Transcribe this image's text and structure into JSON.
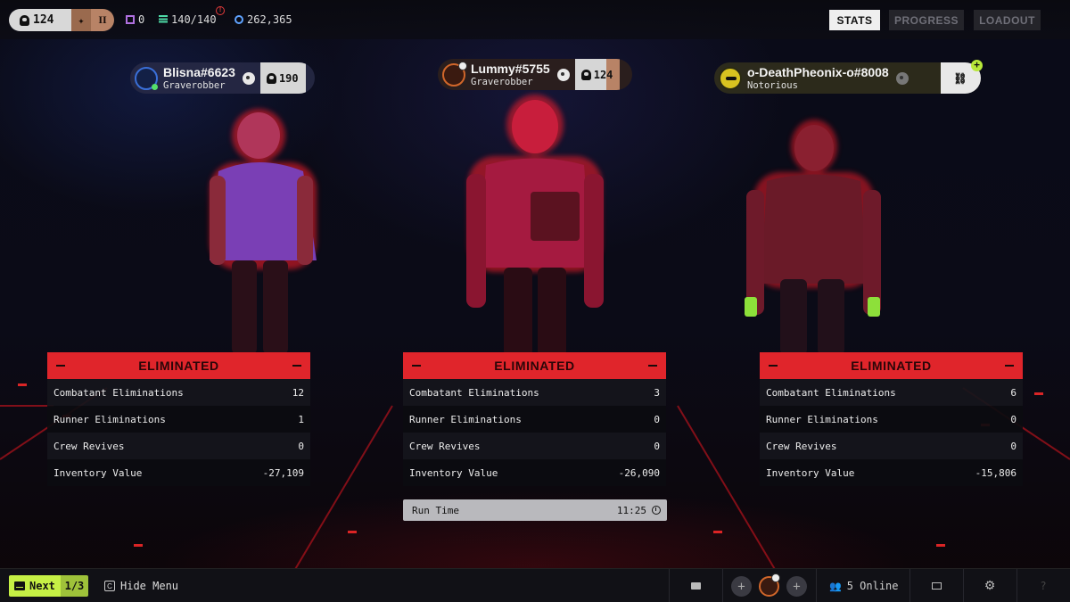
{
  "topbar": {
    "level": "124",
    "rank_numeral": "II",
    "currency_a": "0",
    "capacity": "140/140",
    "credits": "262,365",
    "alert_mark": "!",
    "tabs": [
      {
        "label": "STATS",
        "active": true
      },
      {
        "label": "PROGRESS",
        "active": false
      },
      {
        "label": "LOADOUT",
        "active": false
      }
    ]
  },
  "players": [
    {
      "name": "Blisna#6623",
      "title": "Graverobber",
      "level": "190",
      "status": "ELIMINATED",
      "stats": [
        {
          "label": "Combatant Eliminations",
          "value": "12"
        },
        {
          "label": "Runner Eliminations",
          "value": "1"
        },
        {
          "label": "Crew Revives",
          "value": "0"
        },
        {
          "label": "Inventory Value",
          "value": "-27,109"
        }
      ]
    },
    {
      "name": "Lummy#5755",
      "title": "Graverobber",
      "level": "124",
      "status": "ELIMINATED",
      "stats": [
        {
          "label": "Combatant Eliminations",
          "value": "3"
        },
        {
          "label": "Runner Eliminations",
          "value": "0"
        },
        {
          "label": "Crew Revives",
          "value": "0"
        },
        {
          "label": "Inventory Value",
          "value": "-26,090"
        }
      ],
      "run_time_label": "Run Time",
      "run_time": "11:25"
    },
    {
      "name": "o-DeathPheonix-o#8008",
      "title": "Notorious",
      "status": "ELIMINATED",
      "stats": [
        {
          "label": "Combatant Eliminations",
          "value": "6"
        },
        {
          "label": "Runner Eliminations",
          "value": "0"
        },
        {
          "label": "Crew Revives",
          "value": "0"
        },
        {
          "label": "Inventory Value",
          "value": "-15,806"
        }
      ]
    }
  ],
  "bottombar": {
    "next_label": "Next",
    "page": "1/3",
    "hide_key": "C",
    "hide_label": "Hide Menu",
    "online": "5 Online",
    "help_glyph": "?"
  },
  "colors": {
    "eliminated": "#e0252b",
    "accent_green": "#c6f045",
    "active_tab": "#efefef"
  }
}
